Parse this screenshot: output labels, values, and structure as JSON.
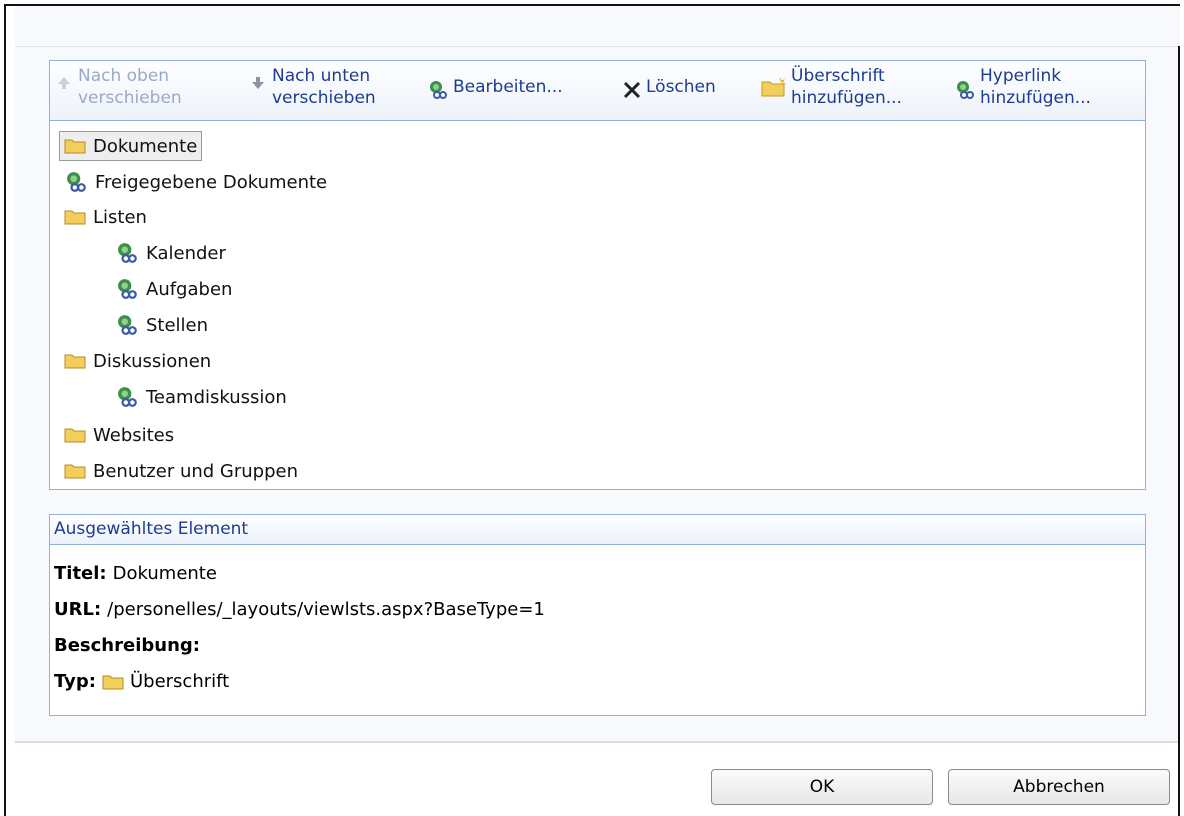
{
  "toolbar": {
    "move_up": [
      "Nach oben",
      "verschieben"
    ],
    "move_down": [
      "Nach unten",
      "verschieben"
    ],
    "edit": "Bearbeiten...",
    "delete": "Löschen",
    "add_heading": [
      "Überschrift",
      "hinzufügen..."
    ],
    "add_link": [
      "Hyperlink",
      "hinzufügen..."
    ]
  },
  "tree": [
    {
      "label": "Dokumente",
      "type": "folder",
      "level": 0,
      "selected": true
    },
    {
      "label": "Freigegebene Dokumente",
      "type": "link",
      "level": 1
    },
    {
      "label": "Listen",
      "type": "folder",
      "level": 0
    },
    {
      "label": "Kalender",
      "type": "link",
      "level": 1
    },
    {
      "label": "Aufgaben",
      "type": "link",
      "level": 1
    },
    {
      "label": "Stellen",
      "type": "link",
      "level": 1
    },
    {
      "label": "Diskussionen",
      "type": "folder",
      "level": 0
    },
    {
      "label": "Teamdiskussion",
      "type": "link",
      "level": 1
    },
    {
      "label": "Websites",
      "type": "folder",
      "level": 0
    },
    {
      "label": "Benutzer und Gruppen",
      "type": "folder",
      "level": 0
    }
  ],
  "details": {
    "header": "Ausgewähltes Element",
    "title_label": "Titel:",
    "title_value": "Dokumente",
    "url_label": "URL:",
    "url_value": "/personelles/_layouts/viewlsts.aspx?BaseType=1",
    "desc_label": "Beschreibung:",
    "type_label": "Typ:",
    "type_value": "Überschrift"
  },
  "buttons": {
    "ok": "OK",
    "cancel": "Abbrechen"
  },
  "colors": {
    "link_text": "#1d3c8f",
    "panel_border": "#8fb1e0",
    "disabled_text": "#9aa9c6"
  }
}
